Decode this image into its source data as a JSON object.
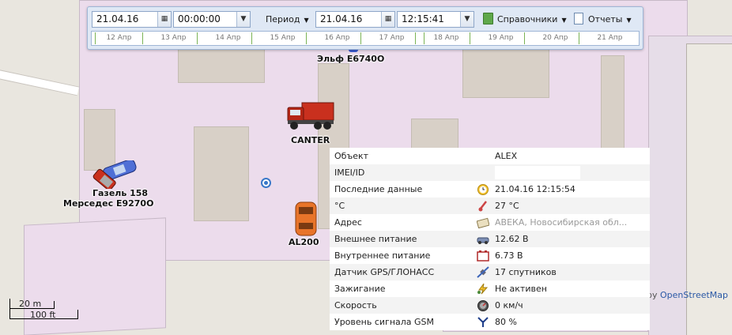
{
  "toolbar": {
    "start_date": "21.04.16",
    "start_time": "00:00:00",
    "period_label": "Период",
    "end_date": "21.04.16",
    "end_time": "12:15:41",
    "directories_label": "Справочники",
    "reports_label": "Отчеты"
  },
  "timeline": {
    "days": [
      "12 Апр",
      "13 Апр",
      "14 Апр",
      "15 Апр",
      "16 Апр",
      "17 Апр",
      "18 Апр",
      "19 Апр",
      "20 Апр",
      "21 Апр"
    ]
  },
  "vehicles": [
    {
      "label": "Эльф E6740O"
    },
    {
      "label": "CANTER"
    },
    {
      "label": "Газель 158"
    },
    {
      "label": "Мерседес E9270O"
    },
    {
      "label": "AL200"
    }
  ],
  "info": {
    "rows": [
      {
        "key": "Объект",
        "value": "ALEX",
        "icon": ""
      },
      {
        "key": "IMEI/ID",
        "value": "",
        "icon": ""
      },
      {
        "key": "Последние данные",
        "value": "21.04.16 12:15:54",
        "icon": "clock-icon"
      },
      {
        "key": "°C",
        "value": "27 °C",
        "icon": "thermometer-icon"
      },
      {
        "key": "Адрес",
        "value": "АВЕКА, Новосибирская обл...",
        "icon": "address-icon"
      },
      {
        "key": "Внешнее питание",
        "value": "12.62 В",
        "icon": "car-battery-icon"
      },
      {
        "key": "Внутреннее питание",
        "value": "6.73 В",
        "icon": "battery-icon"
      },
      {
        "key": "Датчик GPS/ГЛОНАСС",
        "value": "17 спутников",
        "icon": "satellite-icon"
      },
      {
        "key": "Зажигание",
        "value": "Не активен",
        "icon": "ignition-icon"
      },
      {
        "key": "Скорость",
        "value": "0 км/ч",
        "icon": "speedometer-icon"
      },
      {
        "key": "Уровень сигнала GSM",
        "value": "80 %",
        "icon": "antenna-icon"
      }
    ]
  },
  "scale": {
    "meters": "20 m",
    "feet": "100 ft"
  },
  "attribution": {
    "prefix": "by",
    "source": "OpenStreetMap"
  }
}
